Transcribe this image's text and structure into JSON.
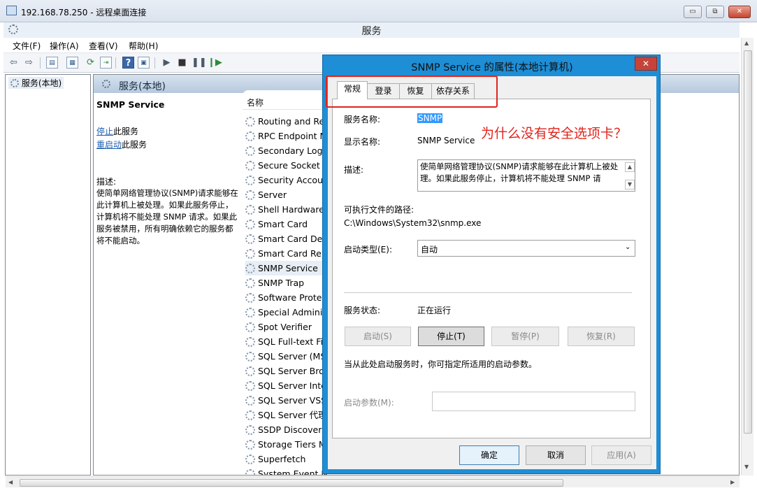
{
  "rdp": {
    "title": "192.168.78.250 - 远程桌面连接",
    "min": "▭",
    "restore": "⧉",
    "close": "✕"
  },
  "services_window": {
    "title": "服务",
    "menu": [
      "文件(F)",
      "操作(A)",
      "查看(V)",
      "帮助(H)"
    ],
    "tree_item": "服务(本地)",
    "header": "服务(本地)",
    "selected_service_name": "SNMP Service",
    "stop_link": "停止",
    "stop_suffix": "此服务",
    "restart_link": "重启动",
    "restart_suffix": "此服务",
    "desc_label": "描述:",
    "desc_text": "使简单网络管理协议(SNMP)请求能够在此计算机上被处理。如果此服务停止，计算机将不能处理 SNMP 请求。如果此服务被禁用，所有明确依赖它的服务都将不能启动。",
    "column_name": "名称",
    "services": [
      "Routing and Re",
      "RPC Endpoint M",
      "Secondary Logo",
      "Secure Socket T",
      "Security Accoun",
      "Server",
      "Shell Hardware",
      "Smart Card",
      "Smart Card Dev",
      "Smart Card Ren",
      "SNMP Service",
      "SNMP Trap",
      "Software Protec",
      "Special Adminis",
      "Spot Verifier",
      "SQL Full-text Filt",
      "SQL Server (MS",
      "SQL Server Brov",
      "SQL Server Inte",
      "SQL Server VSS",
      "SQL Server 代理",
      "SSDP Discovery",
      "Storage Tiers M",
      "Superfetch",
      "System Event N"
    ]
  },
  "dialog": {
    "title": "SNMP Service 的属性(本地计算机)",
    "close": "✕",
    "tabs": [
      "常规",
      "登录",
      "恢复",
      "依存关系"
    ],
    "service_name_label": "服务名称:",
    "service_name_value": "SNMP",
    "display_name_label": "显示名称:",
    "display_name_value": "SNMP Service",
    "description_label": "描述:",
    "description_value": "使简单网络管理协议(SNMP)请求能够在此计算机上被处理。如果此服务停止，计算机将不能处理 SNMP 请",
    "exe_path_label": "可执行文件的路径:",
    "exe_path_value": "C:\\Windows\\System32\\snmp.exe",
    "startup_type_label": "启动类型(E):",
    "startup_type_value": "自动",
    "status_label": "服务状态:",
    "status_value": "正在运行",
    "btn_start": "启动(S)",
    "btn_stop": "停止(T)",
    "btn_pause": "暂停(P)",
    "btn_resume": "恢复(R)",
    "hint": "当从此处启动服务时，你可指定所适用的启动参数。",
    "start_params_label": "启动参数(M):",
    "start_params_value": "",
    "ok": "确定",
    "cancel": "取消",
    "apply": "应用(A)"
  },
  "annotation": {
    "text": "为什么没有安全选项卡？",
    "color": "#e0231b"
  },
  "colors": {
    "dialog_frame": "#1e8ed6",
    "selection": "#3399ff",
    "annotation_red": "#e0231b"
  }
}
